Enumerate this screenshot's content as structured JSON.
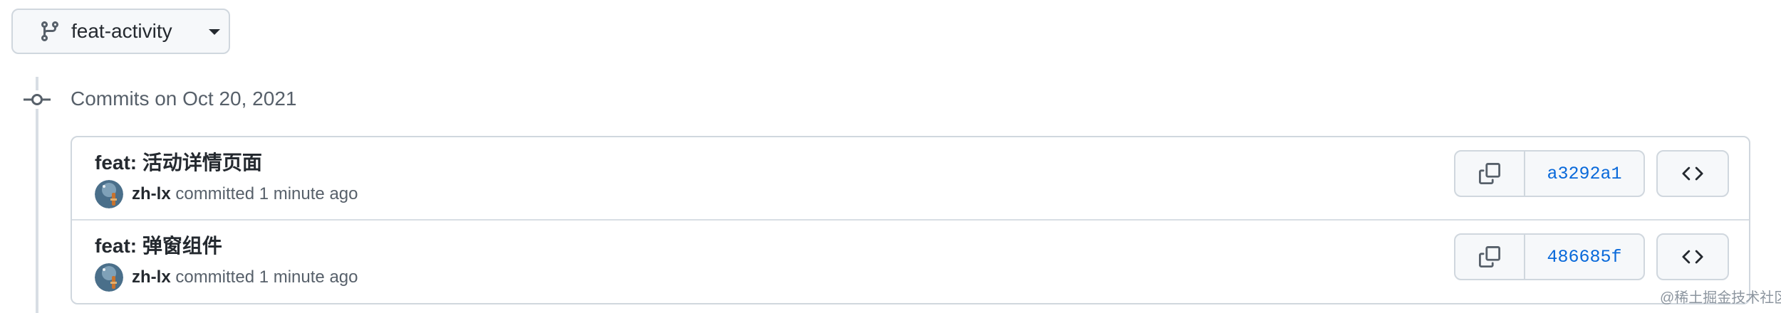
{
  "branch_selector": {
    "label": "feat-activity",
    "icon": "git-branch-icon"
  },
  "timeline": {
    "heading": "Commits on Oct 20, 2021",
    "icon": "git-commit-icon"
  },
  "commits": [
    {
      "title": "feat: 活动详情页面",
      "author": "zh-lx",
      "action": "committed",
      "time": "1 minute ago",
      "sha": "a3292a1"
    },
    {
      "title": "feat: 弹窗组件",
      "author": "zh-lx",
      "action": "committed",
      "time": "1 minute ago",
      "sha": "486685f"
    }
  ],
  "icons": {
    "copy": "copy-icon",
    "browse": "code-icon"
  },
  "colors": {
    "link": "#0969da",
    "border": "#d0d7de",
    "muted": "#57606a",
    "button_bg": "#f6f8fa"
  },
  "watermark": "@稀土掘金技术社区"
}
